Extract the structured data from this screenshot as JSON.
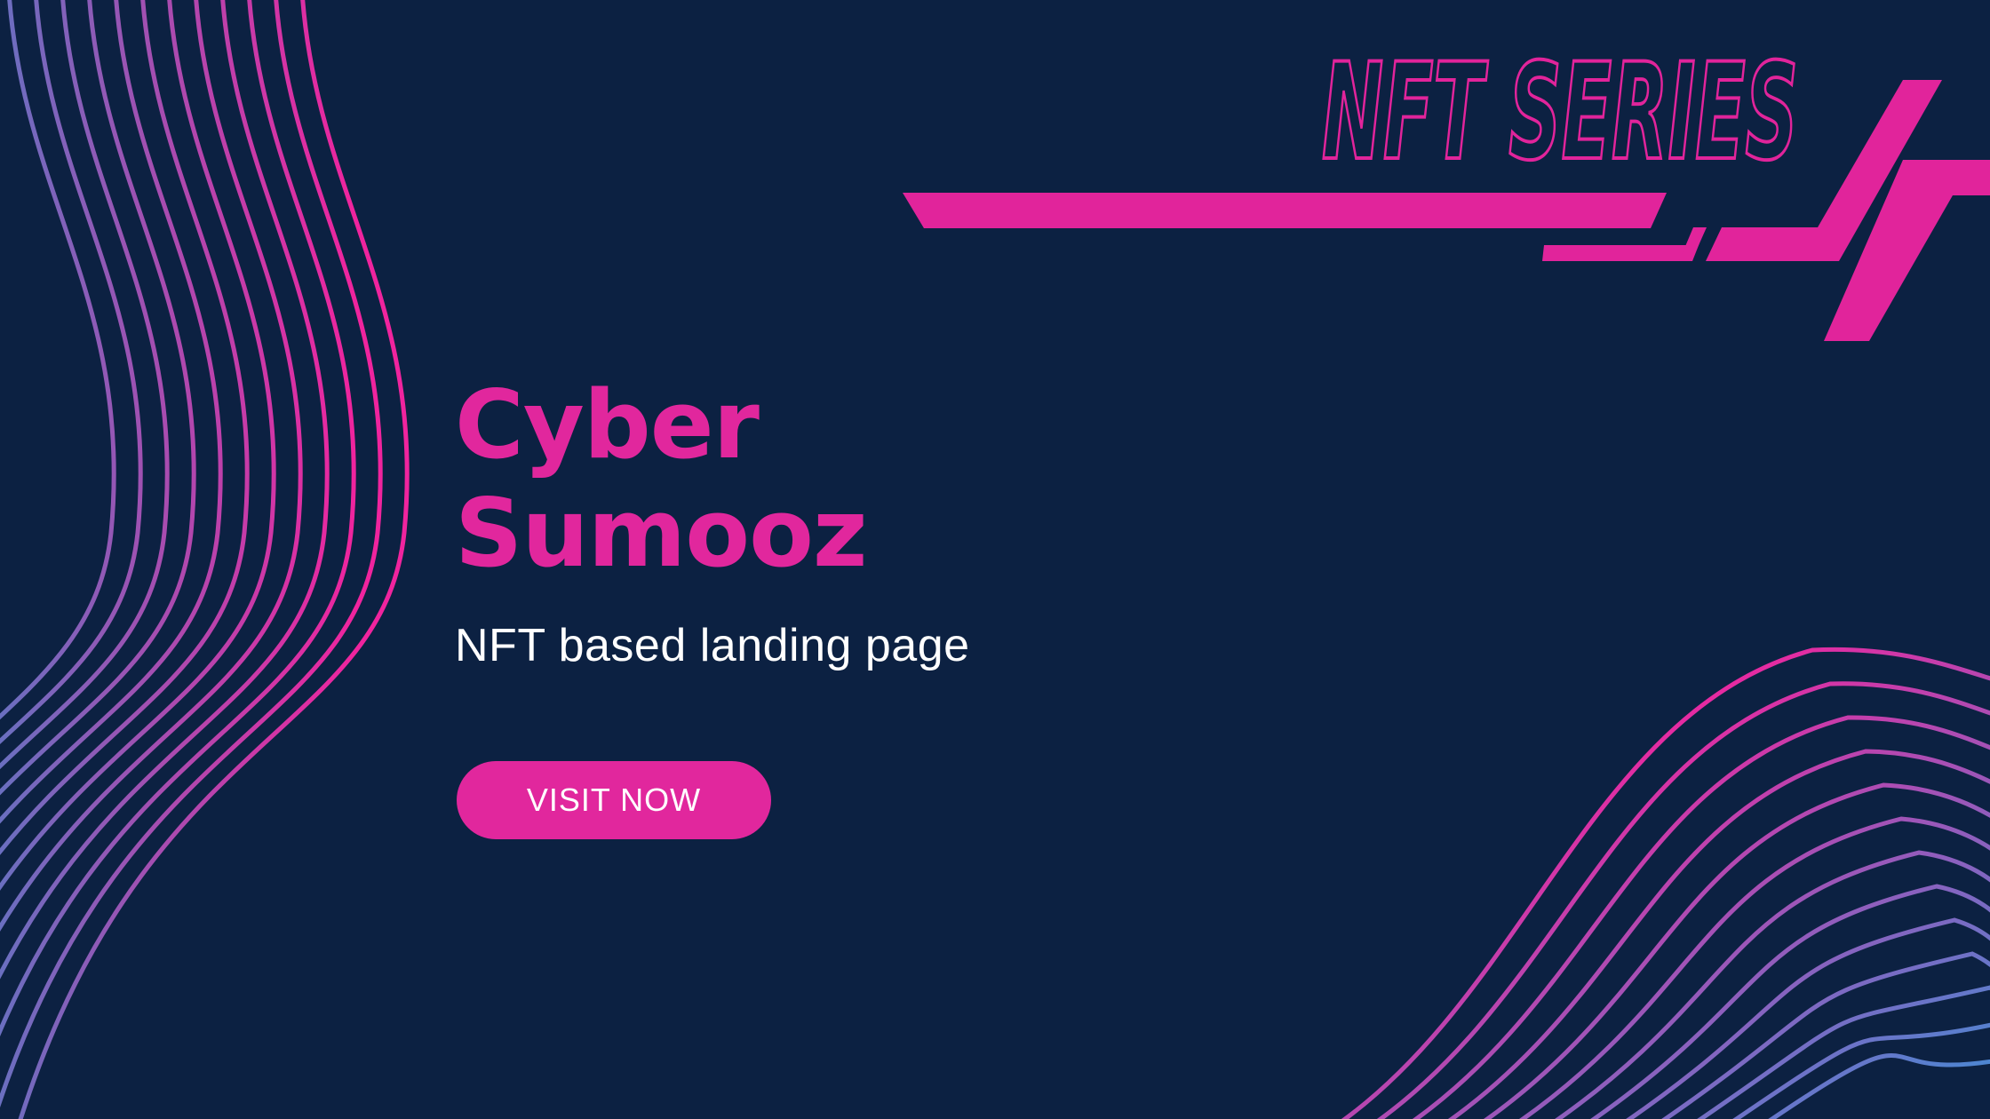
{
  "banner": {
    "series_label": "NFT SERIES",
    "title_line1": "Cyber",
    "title_line2": "Sumooz",
    "subtitle": "NFT based landing page",
    "cta_label": "VISIT NOW"
  },
  "colors": {
    "background": "#0c2142",
    "accent_pink": "#e1279d",
    "gradient_blue": "#4a8ad0",
    "gradient_violet": "#8b5fb8",
    "text_white": "#ffffff"
  }
}
